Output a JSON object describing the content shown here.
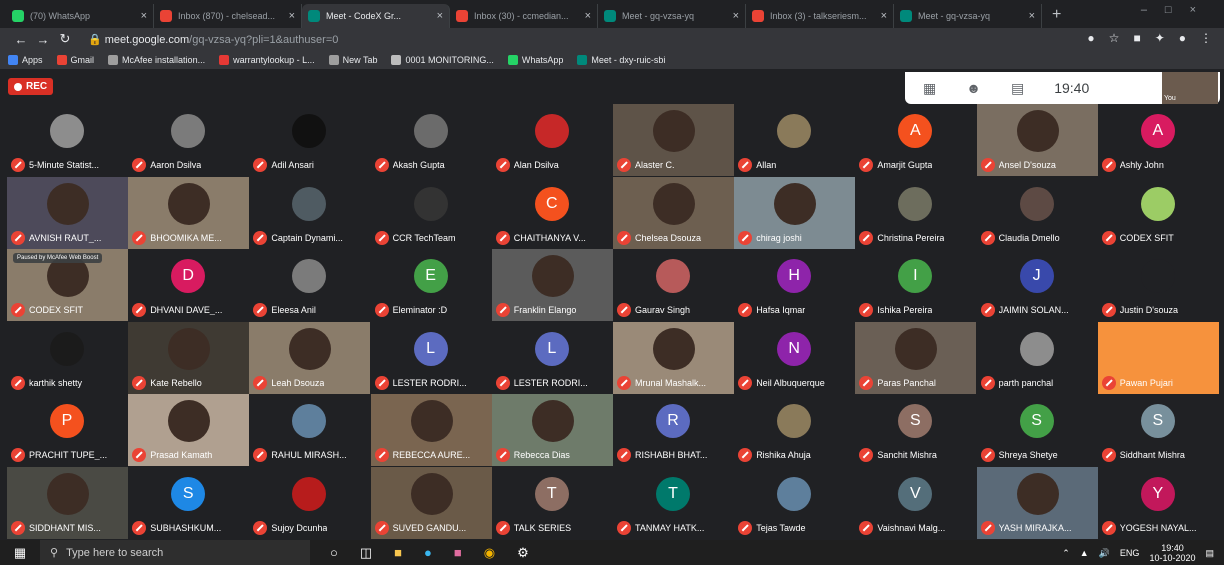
{
  "browser": {
    "tabs": [
      {
        "label": "(70) WhatsApp",
        "color": "#25d366",
        "active": false
      },
      {
        "label": "Inbox (870) - chelsead...",
        "color": "#ea4335",
        "active": false
      },
      {
        "label": "Meet - CodeX Gr...",
        "color": "#00897b",
        "active": true
      },
      {
        "label": "Inbox (30) - ccmedian...",
        "color": "#ea4335",
        "active": false
      },
      {
        "label": "Meet - gq-vzsa-yq",
        "color": "#00897b",
        "active": false
      },
      {
        "label": "Inbox (3) - talkseriesm...",
        "color": "#ea4335",
        "active": false
      },
      {
        "label": "Meet - gq-vzsa-yq",
        "color": "#00897b",
        "active": false
      }
    ],
    "url_host": "meet.google.com",
    "url_rest": "/gq-vzsa-yq?pli=1&authuser=0",
    "bookmarks": [
      {
        "label": "Apps",
        "color": "#4285f4"
      },
      {
        "label": "Gmail",
        "color": "#ea4335"
      },
      {
        "label": "McAfee installation...",
        "color": "#9e9e9e"
      },
      {
        "label": "warrantylookup - L...",
        "color": "#e53935"
      },
      {
        "label": "New Tab",
        "color": "#9e9e9e"
      },
      {
        "label": "0001 MONITORING...",
        "color": "#bdbdbd"
      },
      {
        "label": "WhatsApp",
        "color": "#25d366"
      },
      {
        "label": "Meet - dxy-ruic-sbi",
        "color": "#00897b"
      }
    ]
  },
  "meet": {
    "rec_label": "REC",
    "clock": "19:40",
    "self_label": "You",
    "paused_label": "Paused by McAfee Web Boost",
    "participants": [
      {
        "name": "5-Minute Statist...",
        "kind": "avatar",
        "color": "#8d8d8d",
        "glyph": ""
      },
      {
        "name": "Aaron Dsilva",
        "kind": "avatar",
        "color": "#7b7b7b",
        "glyph": ""
      },
      {
        "name": "Adil Ansari",
        "kind": "avatar",
        "color": "#111111",
        "glyph": ""
      },
      {
        "name": "Akash Gupta",
        "kind": "avatar",
        "color": "#6b6b6b",
        "glyph": ""
      },
      {
        "name": "Alan Dsilva",
        "kind": "avatar",
        "color": "#c62828",
        "glyph": ""
      },
      {
        "name": "Alaster C.",
        "kind": "video",
        "color": "#5e5348",
        "glyph": ""
      },
      {
        "name": "Allan",
        "kind": "avatar",
        "color": "#8a7a5a",
        "glyph": ""
      },
      {
        "name": "Amarjit Gupta",
        "kind": "avatar",
        "color": "#f4511e",
        "glyph": "A"
      },
      {
        "name": "Ansel D'souza",
        "kind": "video",
        "color": "#7a6e61",
        "glyph": ""
      },
      {
        "name": "Ashly John",
        "kind": "avatar",
        "color": "#d81b60",
        "glyph": "A"
      },
      {
        "name": "AVNISH RAUT_...",
        "kind": "video",
        "color": "#4d4a5a",
        "glyph": ""
      },
      {
        "name": "BHOOMIKA ME...",
        "kind": "video",
        "color": "#8a7c6a",
        "glyph": ""
      },
      {
        "name": "Captain Dynami...",
        "kind": "avatar",
        "color": "#4f5b62",
        "glyph": ""
      },
      {
        "name": "CCR TechTeam",
        "kind": "avatar",
        "color": "#333333",
        "glyph": ""
      },
      {
        "name": "CHAITHANYA V...",
        "kind": "avatar",
        "color": "#f4511e",
        "glyph": "C"
      },
      {
        "name": "Chelsea Dsouza",
        "kind": "video",
        "color": "#6d5f50",
        "glyph": ""
      },
      {
        "name": "chirag joshi",
        "kind": "video",
        "color": "#7d8b92",
        "glyph": ""
      },
      {
        "name": "Christina Pereira",
        "kind": "avatar",
        "color": "#6d6d5d",
        "glyph": ""
      },
      {
        "name": "Claudia Dmello",
        "kind": "avatar",
        "color": "#5d4a44",
        "glyph": ""
      },
      {
        "name": "CODEX SFIT",
        "kind": "avatar",
        "color": "#9ccc65",
        "glyph": ""
      },
      {
        "name": "CODEX SFIT",
        "kind": "video",
        "color": "#8a7c6a",
        "glyph": "",
        "paused": true
      },
      {
        "name": "DHVANI DAVE_...",
        "kind": "avatar",
        "color": "#d81b60",
        "glyph": "D"
      },
      {
        "name": "Eleesa Anil",
        "kind": "avatar",
        "color": "#7b7b7b",
        "glyph": ""
      },
      {
        "name": "Eleminator :D",
        "kind": "avatar",
        "color": "#43a047",
        "glyph": "E"
      },
      {
        "name": "Franklin Elango",
        "kind": "video",
        "color": "#5b5b5b",
        "glyph": ""
      },
      {
        "name": "Gaurav Singh",
        "kind": "avatar",
        "color": "#b75a5a",
        "glyph": ""
      },
      {
        "name": "Hafsa Iqmar",
        "kind": "avatar",
        "color": "#8e24aa",
        "glyph": "H"
      },
      {
        "name": "Ishika Pereira",
        "kind": "avatar",
        "color": "#43a047",
        "glyph": "I"
      },
      {
        "name": "JAIMIN SOLAN...",
        "kind": "avatar",
        "color": "#3949ab",
        "glyph": "J"
      },
      {
        "name": "Justin D'souza",
        "kind": "avatar",
        "color": "#202124",
        "glyph": ""
      },
      {
        "name": "karthik shetty",
        "kind": "avatar",
        "color": "#1b1b1b",
        "glyph": ""
      },
      {
        "name": "Kate Rebello",
        "kind": "video",
        "color": "#3f3a33",
        "glyph": ""
      },
      {
        "name": "Leah Dsouza",
        "kind": "video",
        "color": "#8a7c6a",
        "glyph": ""
      },
      {
        "name": "LESTER RODRI...",
        "kind": "avatar",
        "color": "#5c6bc0",
        "glyph": "L"
      },
      {
        "name": "LESTER RODRI...",
        "kind": "avatar",
        "color": "#5c6bc0",
        "glyph": "L"
      },
      {
        "name": "Mrunal Mashalk...",
        "kind": "video",
        "color": "#9a8a78",
        "glyph": ""
      },
      {
        "name": "Neil Albuquerque",
        "kind": "avatar",
        "color": "#8e24aa",
        "glyph": "N"
      },
      {
        "name": "Paras Panchal",
        "kind": "video",
        "color": "#6a5f55",
        "glyph": ""
      },
      {
        "name": "parth panchal",
        "kind": "avatar",
        "color": "#8d8d8d",
        "glyph": ""
      },
      {
        "name": "Pawan Pujari",
        "kind": "video",
        "color": "#f6923d",
        "glyph": ""
      },
      {
        "name": "PRACHIT TUPE_...",
        "kind": "avatar",
        "color": "#f4511e",
        "glyph": "P"
      },
      {
        "name": "Prasad Kamath",
        "kind": "video",
        "color": "#b0a090",
        "glyph": ""
      },
      {
        "name": "RAHUL MIRASH...",
        "kind": "avatar",
        "color": "#5e7f9c",
        "glyph": ""
      },
      {
        "name": "REBECCA AURE...",
        "kind": "video",
        "color": "#7a6550",
        "glyph": ""
      },
      {
        "name": "Rebecca Dias",
        "kind": "video",
        "color": "#6e7b6a",
        "glyph": ""
      },
      {
        "name": "RISHABH BHAT...",
        "kind": "avatar",
        "color": "#5c6bc0",
        "glyph": "R"
      },
      {
        "name": "Rishika Ahuja",
        "kind": "avatar",
        "color": "#8a7a5a",
        "glyph": ""
      },
      {
        "name": "Sanchit Mishra",
        "kind": "avatar",
        "color": "#8d6e63",
        "glyph": "S"
      },
      {
        "name": "Shreya Shetye",
        "kind": "avatar",
        "color": "#43a047",
        "glyph": "S"
      },
      {
        "name": "Siddhant Mishra",
        "kind": "avatar",
        "color": "#78909c",
        "glyph": "S"
      },
      {
        "name": "SIDDHANT MIS...",
        "kind": "video",
        "color": "#4a4a44",
        "glyph": ""
      },
      {
        "name": "SUBHASHKUM...",
        "kind": "avatar",
        "color": "#1e88e5",
        "glyph": "S"
      },
      {
        "name": "Sujoy Dcunha",
        "kind": "avatar",
        "color": "#b71c1c",
        "glyph": ""
      },
      {
        "name": "SUVED GANDU...",
        "kind": "video",
        "color": "#6a5a48",
        "glyph": ""
      },
      {
        "name": "TALK SERIES",
        "kind": "avatar",
        "color": "#8d6e63",
        "glyph": "T"
      },
      {
        "name": "TANMAY HATK...",
        "kind": "avatar",
        "color": "#00796b",
        "glyph": "T"
      },
      {
        "name": "Tejas Tawde",
        "kind": "avatar",
        "color": "#5e7f9c",
        "glyph": ""
      },
      {
        "name": "Vaishnavi Malg...",
        "kind": "avatar",
        "color": "#546e7a",
        "glyph": "V"
      },
      {
        "name": "YASH MIRAJKA...",
        "kind": "video",
        "color": "#5b6a78",
        "glyph": ""
      },
      {
        "name": "YOGESH NAYAL...",
        "kind": "avatar",
        "color": "#c2185b",
        "glyph": "Y"
      }
    ]
  },
  "taskbar": {
    "search_placeholder": "Type here to search",
    "lang": "ENG",
    "time": "19:40",
    "date": "10-10-2020"
  }
}
